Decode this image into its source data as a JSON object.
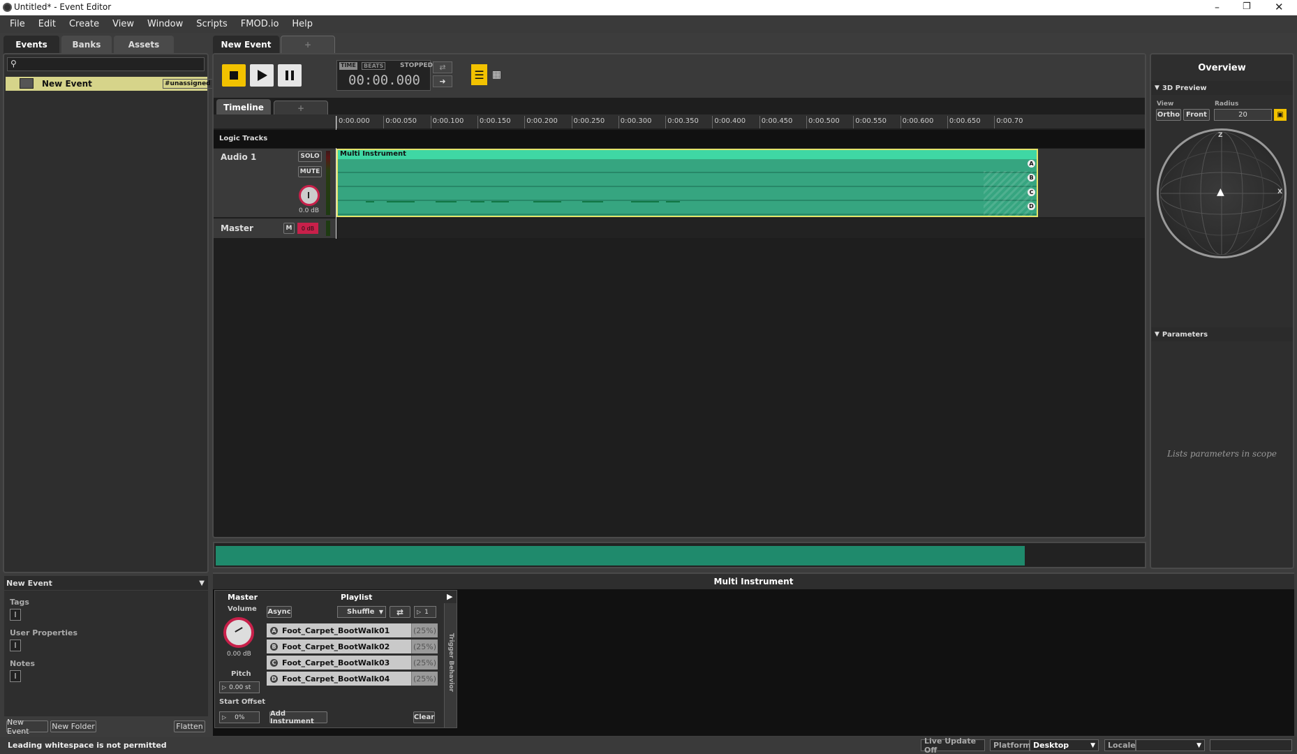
{
  "window": {
    "title": "Untitled* - Event Editor",
    "min_icon": "minimize-icon",
    "max_icon": "restore-icon",
    "close_icon": "close-icon"
  },
  "menu": [
    "File",
    "Edit",
    "Create",
    "View",
    "Window",
    "Scripts",
    "FMOD.io",
    "Help"
  ],
  "browser": {
    "tabs": [
      "Events",
      "Banks",
      "Assets"
    ],
    "search_placeholder": "",
    "items": [
      {
        "name": "New Event",
        "bank": "#unassigned"
      }
    ],
    "selected_name": "New Event",
    "tags_label": "Tags",
    "user_props_label": "User Properties",
    "notes_label": "Notes",
    "new_event": "New Event",
    "new_folder": "New Folder",
    "flatten": "Flatten"
  },
  "editor": {
    "event_tab": "New Event",
    "add_tab": "+",
    "transport": {
      "time": "TIME",
      "beats": "BEATS",
      "state": "STOPPED",
      "display": "00:00.000"
    },
    "timeline_tab": "Timeline",
    "ruler": [
      "0:00.000",
      "0:00.050",
      "0:00.100",
      "0:00.150",
      "0:00.200",
      "0:00.250",
      "0:00.300",
      "0:00.350",
      "0:00.400",
      "0:00.450",
      "0:00.500",
      "0:00.550",
      "0:00.600",
      "0:00.650",
      "0:00.70"
    ],
    "logic_tracks": "Logic Tracks",
    "track": {
      "name": "Audio 1",
      "solo": "SOLO",
      "mute": "MUTE",
      "gain": "0.0 dB"
    },
    "master": {
      "name": "Master",
      "m": "M",
      "level": "0 dB"
    },
    "instrument_title": "Multi Instrument",
    "lanes": [
      "A",
      "B",
      "C",
      "D"
    ]
  },
  "overview": {
    "title": "Overview",
    "preview_head": "3D Preview",
    "view_label": "View",
    "radius_label": "Radius",
    "ortho": "Ortho",
    "front": "Front",
    "radius": "20",
    "axis_z": "Z",
    "axis_x": "X",
    "params_head": "Parameters",
    "params_hint": "Lists parameters in scope"
  },
  "deck": {
    "title": "Multi Instrument",
    "master": "Master",
    "playlist": "Playlist",
    "volume_label": "Volume",
    "volume": "0.00 dB",
    "pitch_label": "Pitch",
    "pitch": "0.00 st",
    "start_offset_label": "Start Offset",
    "start_offset": "0%",
    "async": "Async",
    "mode": "Shuffle",
    "count": "1",
    "items": [
      {
        "letter": "A",
        "name": "Foot_Carpet_BootWalk01",
        "pct": "(25%)"
      },
      {
        "letter": "B",
        "name": "Foot_Carpet_BootWalk02",
        "pct": "(25%)"
      },
      {
        "letter": "C",
        "name": "Foot_Carpet_BootWalk03",
        "pct": "(25%)"
      },
      {
        "letter": "D",
        "name": "Foot_Carpet_BootWalk04",
        "pct": "(25%)"
      }
    ],
    "add_instrument": "Add Instrument",
    "clear": "Clear",
    "trigger": "Trigger Behavior"
  },
  "status": {
    "message": "Leading whitespace is not permitted",
    "live_update": "Live Update Off",
    "platform_label": "Platform",
    "platform": "Desktop",
    "locale_label": "Locale",
    "locale": ""
  },
  "colors": {
    "accent": "#f2c200",
    "instrument": "#3fd7a4",
    "selection": "#d6d48a",
    "knob_ring": "#c8204a"
  }
}
